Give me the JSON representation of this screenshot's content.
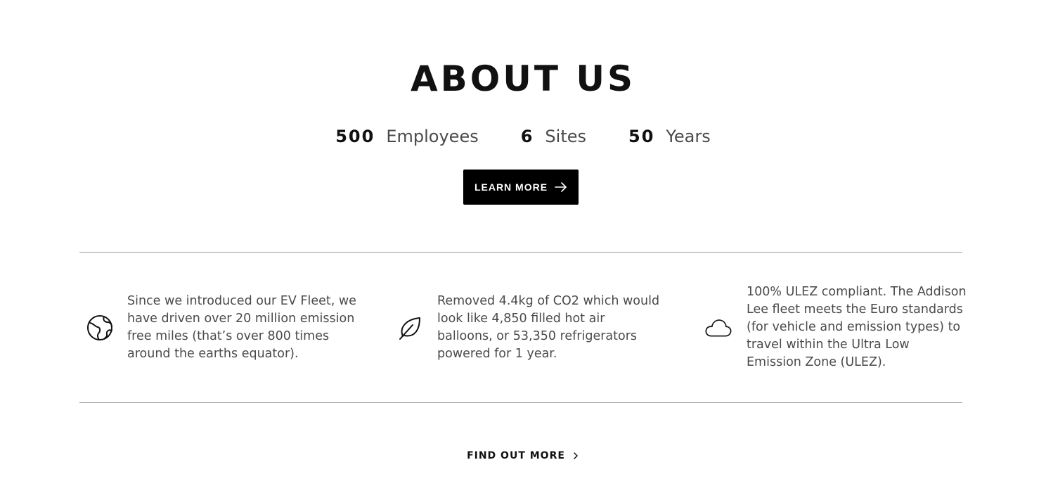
{
  "section": {
    "title": "ABOUT US"
  },
  "stats": [
    {
      "number": "500",
      "label": "Employees"
    },
    {
      "number": "6",
      "label": "Sites"
    },
    {
      "number": "50",
      "label": "Years"
    }
  ],
  "cta": {
    "learn_more_label": "LEARN MORE",
    "learn_more_icon": "arrow-right-icon"
  },
  "features": [
    {
      "icon": "globe-icon",
      "text": "Since we introduced our EV Fleet, we have driven over 20 million emission free miles (that’s over 800 times around the earths equator)."
    },
    {
      "icon": "leaf-icon",
      "text": "Removed 4.4kg of CO2 which would look like 4,850 filled hot air balloons, or 53,350 refrigerators powered for 1 year."
    },
    {
      "icon": "cloud-icon",
      "text": "100% ULEZ compliant. The Addison Lee fleet meets the Euro standards (for vehicle and emission types) to travel within the Ultra Low Emission Zone (ULEZ)."
    }
  ],
  "footer_link": {
    "label": "FIND OUT MORE",
    "icon": "chevron-right-icon"
  },
  "colors": {
    "button_bg": "#000000",
    "button_text": "#ffffff",
    "body_text": "#4a4a4a",
    "divider": "#9a9a9a"
  }
}
